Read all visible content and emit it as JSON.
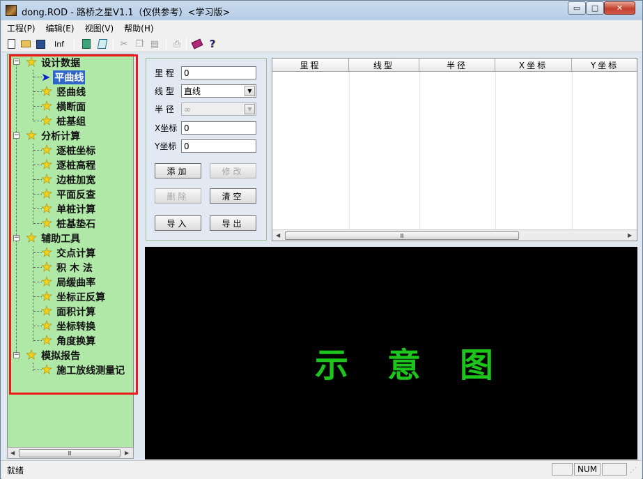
{
  "window": {
    "title": "dong.ROD - 路桥之星V1.1（仅供参考）<学习版>",
    "controls": {
      "minimize": "▭",
      "maximize": "□",
      "close": "✕"
    }
  },
  "menu": [
    "工程(P)",
    "编辑(E)",
    "视图(V)",
    "帮助(H)"
  ],
  "toolbar": {
    "info_label": "Inf",
    "icons": [
      "new-file-icon",
      "open-folder-icon",
      "save-icon",
      "calculator-icon",
      "sheet-icon",
      "cut-icon",
      "copy-icon",
      "paste-icon",
      "print-icon",
      "book-icon",
      "help-icon"
    ]
  },
  "tree": {
    "groups": [
      {
        "label": "设计数据",
        "children": [
          "平曲线",
          "竖曲线",
          "横断面",
          "桩基组"
        ]
      },
      {
        "label": "分析计算",
        "children": [
          "逐桩坐标",
          "逐桩高程",
          "边桩加宽",
          "平面反查",
          "单桩计算",
          "桩基垫石"
        ]
      },
      {
        "label": "辅助工具",
        "children": [
          "交点计算",
          "积 木 法",
          "局缓曲率",
          "坐标正反算",
          "面积计算",
          "坐标转换",
          "角度换算"
        ]
      },
      {
        "label": "模拟报告",
        "children": [
          "施工放线测量记"
        ]
      }
    ],
    "selected": "平曲线",
    "highlight_color": "#f01818"
  },
  "form": {
    "mileage_label": "里  程",
    "mileage_value": "0",
    "line_type_label": "线  型",
    "line_type_value": "直线",
    "radius_label": "半  径",
    "radius_value": "∞",
    "x_label": "X坐标",
    "x_value": "0",
    "y_label": "Y坐标",
    "y_value": "0",
    "buttons": {
      "add": "添加",
      "modify": "修改",
      "delete": "删除",
      "clear": "清空",
      "import": "导入",
      "export": "导出"
    }
  },
  "grid": {
    "columns": [
      "里程",
      "线型",
      "半径",
      "X坐标",
      "Y坐标"
    ],
    "scroll_glyph": "Ⅲ"
  },
  "diagram": {
    "title": "示意图",
    "text_color": "#1cc41c"
  },
  "status": {
    "text": "就绪",
    "num_indicator": "NUM"
  }
}
